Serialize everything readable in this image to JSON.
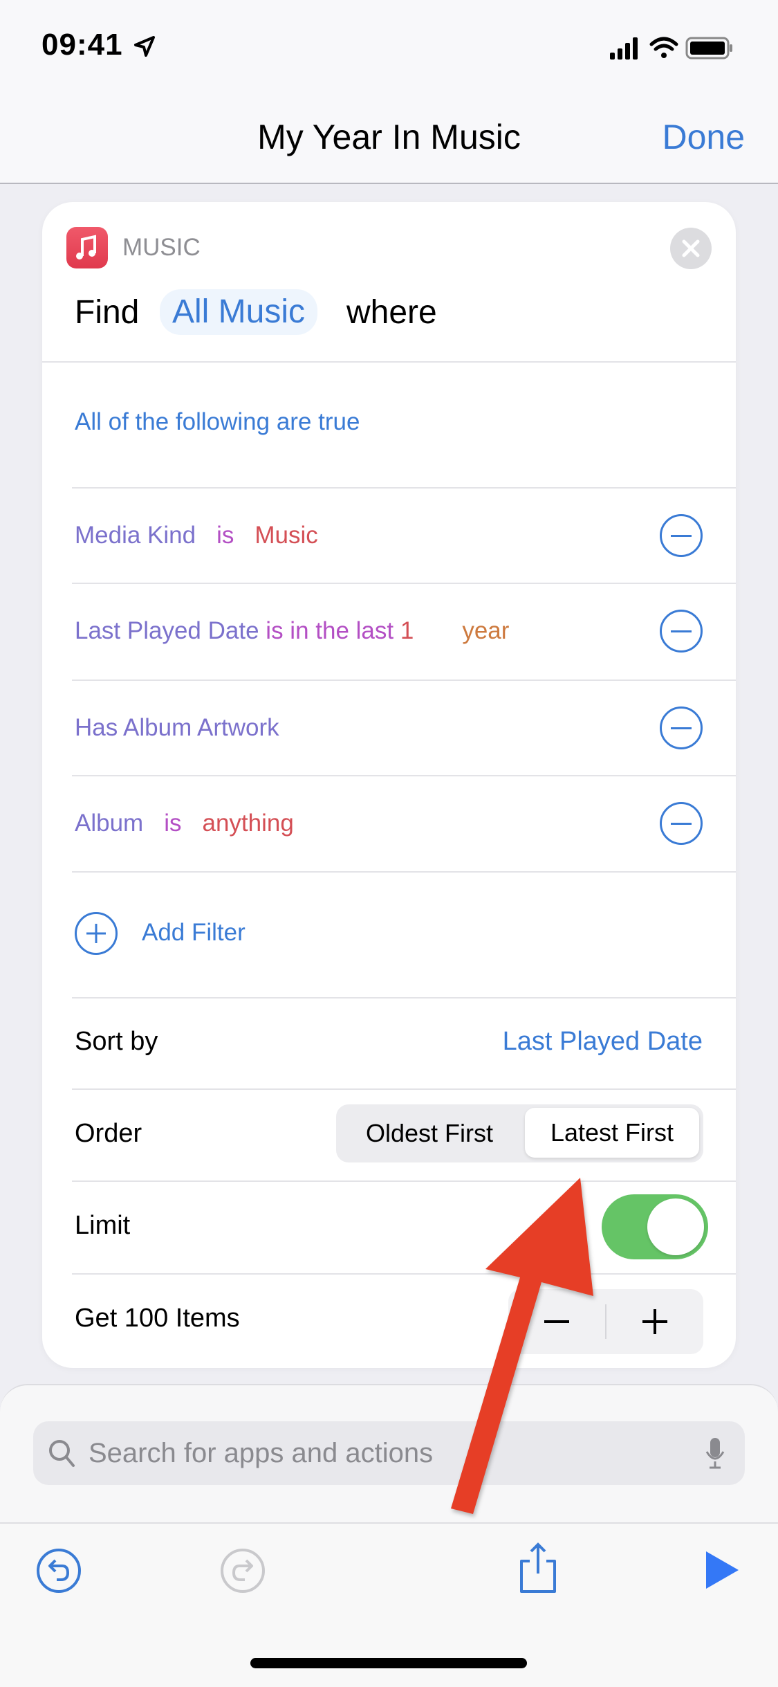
{
  "status_bar": {
    "time": "09:41",
    "icons": [
      "location-arrow-icon",
      "signal-icon",
      "wifi-icon",
      "battery-icon"
    ]
  },
  "nav": {
    "title": "My Year In Music",
    "done_label": "Done"
  },
  "action": {
    "app_label": "MUSIC",
    "find_word": "Find",
    "scope": "All Music",
    "where_word": "where",
    "condition_mode": "All of the following are true",
    "filters": [
      {
        "field": "Media Kind",
        "operator": "is",
        "value": "Music",
        "unit": ""
      },
      {
        "field": "Last Played Date",
        "operator": "is in the last",
        "value": "1",
        "unit": "year"
      },
      {
        "field": "Has Album Artwork",
        "operator": "",
        "value": "",
        "unit": ""
      },
      {
        "field": "Album",
        "operator": "is",
        "value": "anything",
        "unit": ""
      }
    ],
    "add_filter_label": "Add Filter",
    "sort_by_label": "Sort by",
    "sort_by_value": "Last Played Date",
    "order_label": "Order",
    "order_options": [
      "Oldest First",
      "Latest First"
    ],
    "order_selected": "Latest First",
    "limit_label": "Limit",
    "limit_on": true,
    "get_items_label": "Get 100 Items"
  },
  "search": {
    "placeholder": "Search for apps and actions"
  },
  "colors": {
    "accent": "#3a7bd5",
    "toggle_on": "#65c466",
    "annotation_arrow": "#e63e26",
    "music_icon": "#e8485a"
  }
}
